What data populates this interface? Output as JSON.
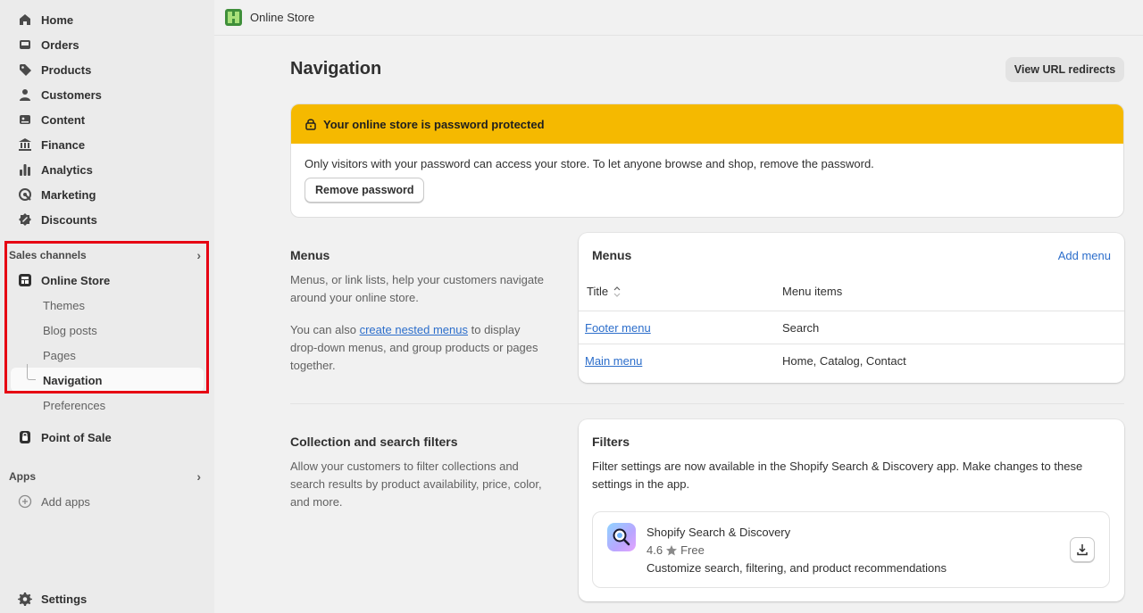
{
  "sidebar": {
    "items": [
      {
        "label": "Home",
        "icon": "home-icon"
      },
      {
        "label": "Orders",
        "icon": "inbox-icon"
      },
      {
        "label": "Products",
        "icon": "tag-icon"
      },
      {
        "label": "Customers",
        "icon": "person-icon"
      },
      {
        "label": "Content",
        "icon": "image-icon"
      },
      {
        "label": "Finance",
        "icon": "bank-icon"
      },
      {
        "label": "Analytics",
        "icon": "bar-chart-icon"
      },
      {
        "label": "Marketing",
        "icon": "target-icon"
      },
      {
        "label": "Discounts",
        "icon": "discount-icon"
      }
    ],
    "sales_channels_label": "Sales channels",
    "online_store_label": "Online Store",
    "sub_items": [
      "Themes",
      "Blog posts",
      "Pages",
      "Navigation",
      "Preferences"
    ],
    "point_of_sale_label": "Point of Sale",
    "apps_label": "Apps",
    "add_apps_label": "Add apps",
    "settings_label": "Settings"
  },
  "topbar": {
    "title": "Online Store"
  },
  "page": {
    "title": "Navigation",
    "view_redirects_label": "View URL redirects"
  },
  "banner": {
    "title": "Your online store is password protected",
    "message": "Only visitors with your password can access your store. To let anyone browse and shop, remove the password.",
    "button_label": "Remove password",
    "color": "#f5b900"
  },
  "menus_section": {
    "title": "Menus",
    "desc1": "Menus, or link lists, help your customers navigate around your online store.",
    "desc2_prefix": "You can also ",
    "desc2_link": "create nested menus",
    "desc2_suffix": " to display drop-down menus, and group products or pages together."
  },
  "menus_card": {
    "title": "Menus",
    "add_label": "Add menu",
    "col_title": "Title",
    "col_items": "Menu items",
    "rows": [
      {
        "title": "Footer menu",
        "items": "Search"
      },
      {
        "title": "Main menu",
        "items": "Home, Catalog, Contact"
      }
    ]
  },
  "filters_section": {
    "title": "Collection and search filters",
    "desc": "Allow your customers to filter collections and search results by product availability, price, color, and more."
  },
  "filters_card": {
    "title": "Filters",
    "desc": "Filter settings are now available in the Shopify Search & Discovery app. Make changes to these settings in the app.",
    "app_name": "Shopify Search & Discovery",
    "rating": "4.6",
    "price": "Free",
    "app_desc": "Customize search, filtering, and product recommendations"
  }
}
